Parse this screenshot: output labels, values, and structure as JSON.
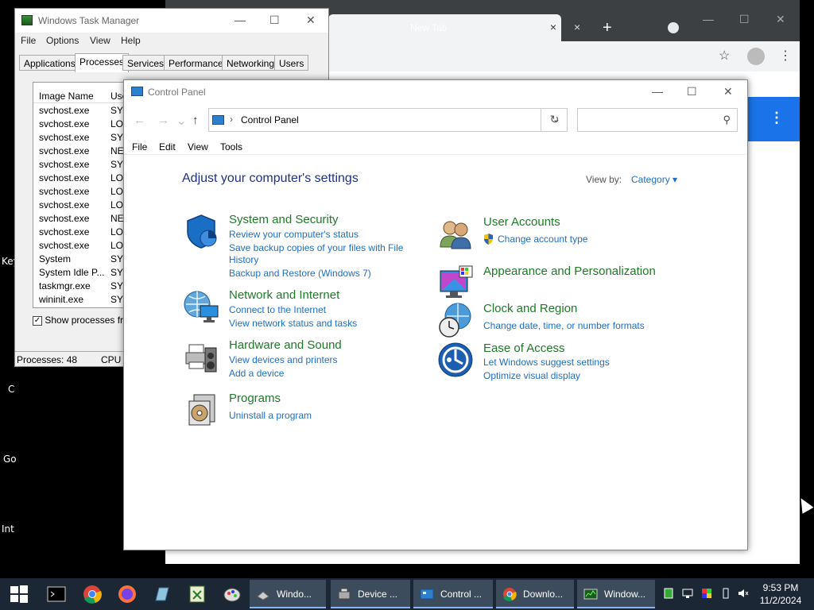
{
  "desktop": {
    "labels": [
      "Key",
      "C",
      "Go",
      "Int"
    ]
  },
  "chrome": {
    "tab_active_close": "×",
    "tab_new_label": "New Tab",
    "tab_new_close": "×",
    "new_tab_plus": "+",
    "win_min": "—",
    "win_max": "☐",
    "win_close": "✕",
    "star": "☆",
    "kebab": "⋮",
    "side_kebab": "⋮"
  },
  "taskmgr": {
    "title": "Windows Task Manager",
    "win_min": "—",
    "win_max": "☐",
    "win_close": "✕",
    "menu": [
      "File",
      "Options",
      "View",
      "Help"
    ],
    "tabs": [
      "Applications",
      "Processes",
      "Services",
      "Performance",
      "Networking",
      "Users"
    ],
    "active_tab": "Processes",
    "columns": [
      "Image Name",
      "Use"
    ],
    "rows": [
      {
        "name": "svchost.exe",
        "user": "SYS"
      },
      {
        "name": "svchost.exe",
        "user": "LOC"
      },
      {
        "name": "svchost.exe",
        "user": "SYS"
      },
      {
        "name": "svchost.exe",
        "user": "NET"
      },
      {
        "name": "svchost.exe",
        "user": "SYS"
      },
      {
        "name": "svchost.exe",
        "user": "LOC"
      },
      {
        "name": "svchost.exe",
        "user": "LOC"
      },
      {
        "name": "svchost.exe",
        "user": "LOC"
      },
      {
        "name": "svchost.exe",
        "user": "NET"
      },
      {
        "name": "svchost.exe",
        "user": "LOC"
      },
      {
        "name": "svchost.exe",
        "user": "LOC"
      },
      {
        "name": "System",
        "user": "SYS"
      },
      {
        "name": "System Idle P...",
        "user": "SYS"
      },
      {
        "name": "taskmgr.exe",
        "user": "SYS"
      },
      {
        "name": "wininit.exe",
        "user": "SYS"
      }
    ],
    "show_all_label": "Show processes from",
    "show_all_checked": "✓",
    "status_processes": "Processes: 48",
    "status_cpu": "CPU U"
  },
  "controlpanel": {
    "title": "Control Panel",
    "win_min": "—",
    "win_max": "☐",
    "win_close": "✕",
    "nav_back": "←",
    "nav_forward": "→",
    "nav_recent": "⌄",
    "nav_up": "↑",
    "address_sep": "›",
    "address_path": "Control Panel",
    "address_dropdown": "⌄",
    "refresh": "↻",
    "search_placeholder": "",
    "search_icon": "⚲",
    "menu": [
      "File",
      "Edit",
      "View",
      "Tools"
    ],
    "heading": "Adjust your computer's settings",
    "view_by_label": "View by:",
    "view_by_value": "Category ▾",
    "categories_left": [
      {
        "title": "System and Security",
        "links": [
          "Review your computer's status",
          "Save backup copies of your files with File",
          "History",
          "Backup and Restore (Windows 7)"
        ]
      },
      {
        "title": "Network and Internet",
        "links": [
          "Connect to the Internet",
          "View network status and tasks"
        ]
      },
      {
        "title": "Hardware and Sound",
        "links": [
          "View devices and printers",
          "Add a device"
        ]
      },
      {
        "title": "Programs",
        "links": [
          "Uninstall a program"
        ]
      }
    ],
    "categories_right": [
      {
        "title": "User Accounts",
        "links": [
          "Change account type"
        ]
      },
      {
        "title": "Appearance and Personalization",
        "links": []
      },
      {
        "title": "Clock and Region",
        "links": [
          "Change date, time, or number formats"
        ]
      },
      {
        "title": "Ease of Access",
        "links": [
          "Let Windows suggest settings",
          "Optimize visual display"
        ]
      }
    ]
  },
  "taskbar": {
    "buttons": [
      {
        "label": "Windo...",
        "icon": "window-icon"
      },
      {
        "label": "Device ...",
        "icon": "device-manager-icon"
      },
      {
        "label": "Control ...",
        "icon": "control-panel-icon"
      },
      {
        "label": "Downlo...",
        "icon": "chrome-icon"
      },
      {
        "label": "Window...",
        "icon": "task-manager-icon"
      }
    ],
    "time": "9:53 PM",
    "date": "11/2/2024"
  },
  "colors": {
    "cp_link": "#1f6fc5",
    "cp_category": "#1f7a28",
    "cp_heading": "#1e3287",
    "taskbar_bg": "#1b2735",
    "chrome_dark": "#3c4043"
  }
}
